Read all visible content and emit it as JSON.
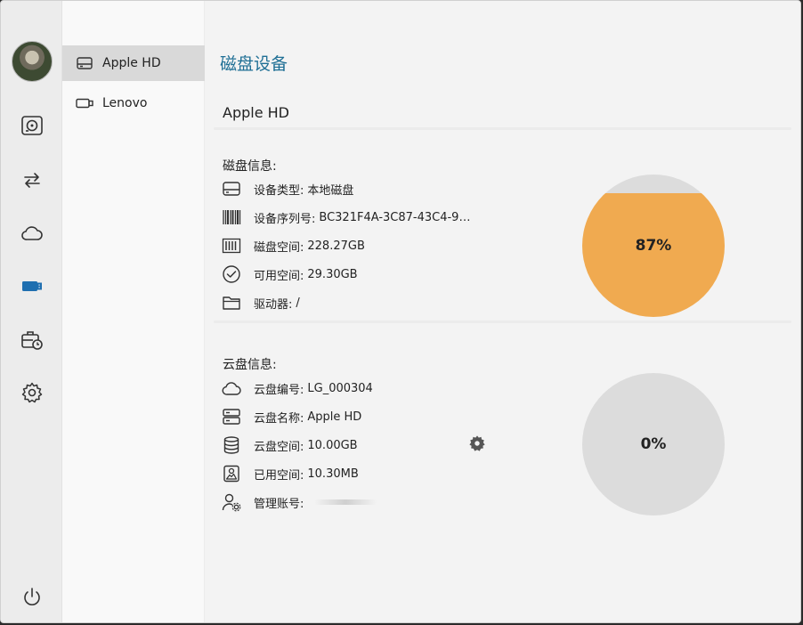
{
  "window": {
    "minimize_icon": "minimize-icon",
    "maximize_icon": "maximize-icon"
  },
  "rail": {
    "items": [
      {
        "name": "disk",
        "icon": "hard-drive-icon"
      },
      {
        "name": "transfer",
        "icon": "arrows-exchange-icon"
      },
      {
        "name": "cloud",
        "icon": "cloud-icon"
      },
      {
        "name": "usb",
        "icon": "usb-drive-icon",
        "active": true
      },
      {
        "name": "backup",
        "icon": "briefcase-clock-icon"
      },
      {
        "name": "settings",
        "icon": "gear-icon"
      }
    ],
    "power_icon": "power-icon"
  },
  "devices": [
    {
      "label": "Apple HD",
      "icon": "drive-icon",
      "active": true
    },
    {
      "label": "Lenovo",
      "icon": "usb-device-icon",
      "active": false
    }
  ],
  "main": {
    "page_title": "磁盘设备",
    "device_name": "Apple HD",
    "disk_info": {
      "title": "磁盘信息:",
      "rows": [
        {
          "label": "设备类型:",
          "value": "本地磁盘",
          "icon": "drive-icon"
        },
        {
          "label": "设备序列号:",
          "value": "BC321F4A-3C87-43C4-983…",
          "icon": "barcode-icon"
        },
        {
          "label": "磁盘空间:",
          "value": "228.27GB",
          "icon": "storage-bars-icon"
        },
        {
          "label": "可用空间:",
          "value": "29.30GB",
          "icon": "check-circle-icon"
        },
        {
          "label": "驱动器:",
          "value": "/",
          "icon": "folder-icon"
        }
      ],
      "usage_percent_label": "87%",
      "usage_fraction": 0.87
    },
    "cloud_info": {
      "title": "云盘信息:",
      "rows": [
        {
          "label": "云盘编号:",
          "value": "LG_000304",
          "icon": "cloud-icon"
        },
        {
          "label": "云盘名称:",
          "value": "Apple HD",
          "icon": "server-icon"
        },
        {
          "label": "云盘空间:",
          "value": "10.00GB",
          "icon": "database-icon"
        },
        {
          "label": "已用空间:",
          "value": "10.30MB",
          "icon": "image-box-icon"
        },
        {
          "label": "管理账号:",
          "value": "",
          "icon": "user-gear-icon"
        }
      ],
      "usage_percent_label": "0%",
      "usage_fraction": 0.0,
      "settings_icon": "gear-icon"
    }
  },
  "colors": {
    "accent": "#1f6f95",
    "usage_fill": "#f0aa50",
    "usage_empty": "#dcdcdc",
    "usb_active": "#1f6fb0"
  }
}
